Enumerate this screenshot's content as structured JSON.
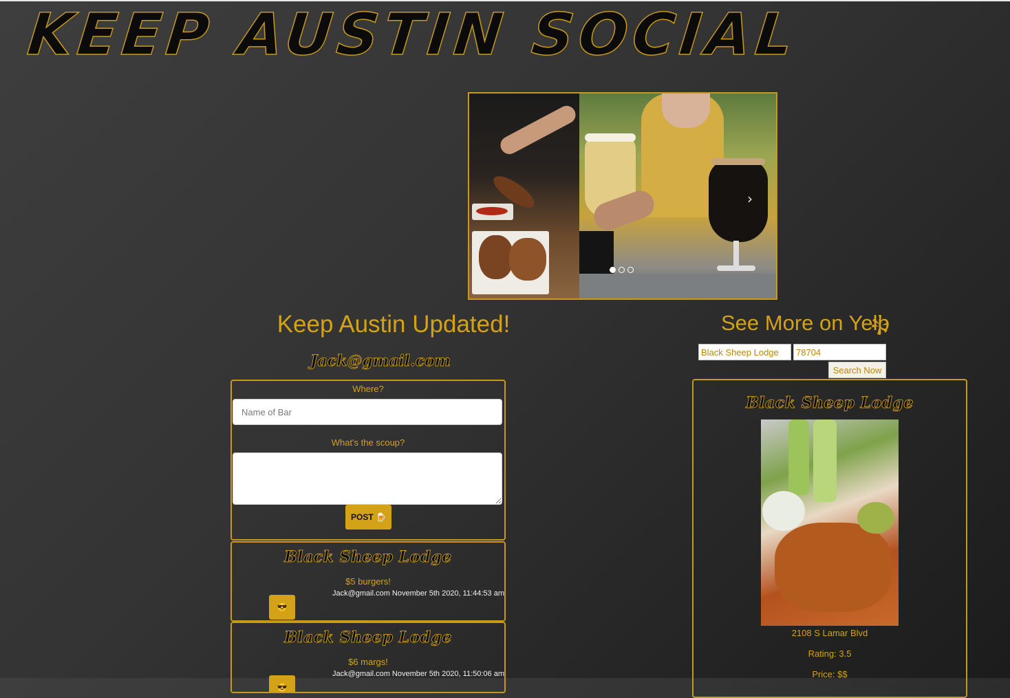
{
  "site": {
    "title": "KEEP AUSTIN SOCIAL"
  },
  "carousel": {
    "next_label": "›",
    "slide_count": 3,
    "active_index": 0
  },
  "updates": {
    "heading": "Keep Austin Updated!",
    "user_email": "Jack@gmail.com",
    "form": {
      "where_label": "Where?",
      "bar_placeholder": "Name of Bar",
      "scoop_label": "What's the scoup?",
      "scoop_value": "",
      "post_label": "POST 🍺"
    },
    "posts": [
      {
        "bar": "Black Sheep Lodge",
        "text": "$5 burgers!",
        "meta": "Jack@gmail.com November 5th 2020, 11:44:53 am",
        "reaction": "😎"
      },
      {
        "bar": "Black Sheep Lodge",
        "text": "$6 margs!",
        "meta": "Jack@gmail.com November 5th 2020, 11:50:06 am",
        "reaction": "😎"
      }
    ]
  },
  "yelp": {
    "heading": "See More on Yelp",
    "icon": "yelp-burst-icon",
    "search_term": "Black Sheep Lodge",
    "zip": "78704",
    "search_label": "Search Now",
    "result": {
      "name": "Black Sheep Lodge",
      "address": "2108 S Lamar Blvd",
      "rating": "Rating: 3.5",
      "price": "Price: $$"
    }
  },
  "colors": {
    "accent": "#d4a217",
    "background_dark": "#1c1c1c",
    "background_light": "#3e3e3e",
    "meta_text": "#f2f2f2"
  }
}
